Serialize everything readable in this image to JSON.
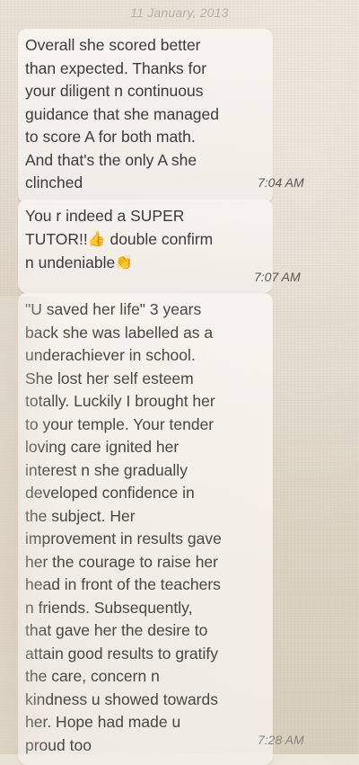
{
  "date_header": "11 January, 2013",
  "messages": [
    {
      "text": "Overall she scored better\nthan expected. Thanks for\nyour diligent n continuous\nguidance that she managed\nto score A for both math.\nAnd that's the only A she\nclinched",
      "time": "7:04 AM"
    },
    {
      "line1": "You r indeed a SUPER",
      "line2_a": "TUTOR!!",
      "line2_b": " double confirm",
      "line3": "n undeniable",
      "time": "7:07 AM",
      "emoji": [
        "thumbs-up-icon",
        "clapping-hands-icon"
      ]
    },
    {
      "text": "\"U saved her life\" 3 years\nback she was labelled as a\nunderachiever in school.\nShe lost her self esteem\ntotally. Luckily I brought her\nto your temple. Your tender\nloving care ignited her\ninterest n she gradually\ndeveloped confidence in\nthe subject. Her\nimprovement in results gave\nher the courage to raise her\nhead in front of the teachers\nn friends. Subsequently,\nthat gave her the desire to\nattain good results to gratify\nthe care, concern n\nkindness u showed towards\nher. Hope        had made u\nproud too",
      "time": "7:28 AM"
    }
  ]
}
